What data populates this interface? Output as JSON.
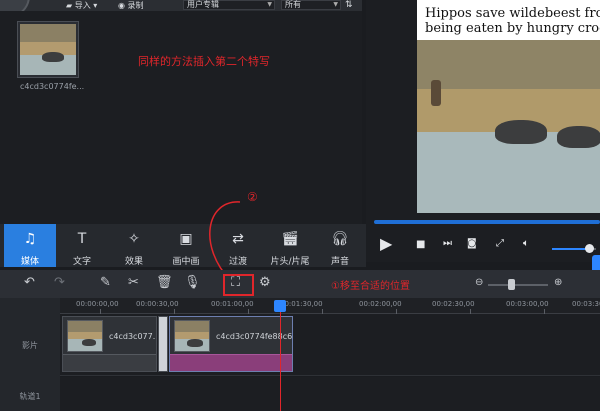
{
  "topbar": {
    "import_label": "导入",
    "record_label": "录制",
    "album_select": "用户专辑",
    "filter_select": "所有"
  },
  "media": {
    "thumb_label": "c4cd3c0774fe...",
    "instruction": "同样的方法插入第二个特写"
  },
  "preview": {
    "caption": "Hippos save wildebeest from\nbeing eaten by hungry crococ",
    "progress": 1.0,
    "volume": 0.85
  },
  "tabs": [
    {
      "label": "媒体",
      "icon": "media-icon",
      "active": true
    },
    {
      "label": "文字",
      "icon": "text-icon",
      "active": false
    },
    {
      "label": "效果",
      "icon": "effects-icon",
      "active": false
    },
    {
      "label": "画中画",
      "icon": "pip-icon",
      "active": false
    },
    {
      "label": "过渡",
      "icon": "transition-icon",
      "active": false
    },
    {
      "label": "片头/片尾",
      "icon": "intro-outro-icon",
      "active": false
    },
    {
      "label": "声音",
      "icon": "sound-icon",
      "active": false
    }
  ],
  "annotations": {
    "step1": "①移至合适的位置",
    "step2": "②"
  },
  "ruler": [
    "00:00:00,00",
    "00:00:30,00",
    "00:01:00,00",
    "00:01:30,00",
    "00:02:00,00",
    "00:02:30,00",
    "00:03:00,00",
    "00:03:30,0"
  ],
  "tracks": {
    "video_label": "影片",
    "track1_label": "轨道1",
    "clip1_name": "c4cd3c077...",
    "clip2_name": "c4cd3c0774fe88c6..."
  },
  "colors": {
    "accent": "#2a7fe0",
    "annotation": "#e0262b",
    "clip2_fill": "#8a3e7a"
  }
}
